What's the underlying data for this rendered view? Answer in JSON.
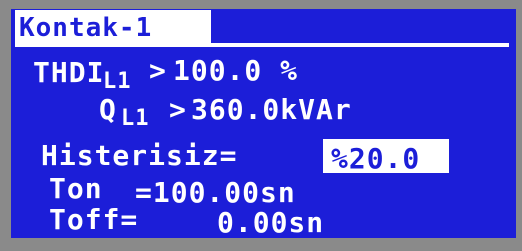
{
  "title": "Kontak-1",
  "rows": {
    "thdi_label": "THDI",
    "thdi_sub": "L1",
    "thdi_op": ">",
    "thdi_value": "100.0 %",
    "q_label": "Q",
    "q_sub": "L1",
    "q_op": ">",
    "q_value": "360.0kVAr",
    "hyst_label": "Histerisiz=",
    "hyst_value": "%20.0",
    "ton_label": "Ton",
    "ton_value": "=100.00sn",
    "toff_label": "Toff=",
    "toff_value": "0.00sn"
  },
  "colors": {
    "screen_bg": "#1c1ed8",
    "text": "#ffffff",
    "bezel": "#8a8a8a"
  }
}
